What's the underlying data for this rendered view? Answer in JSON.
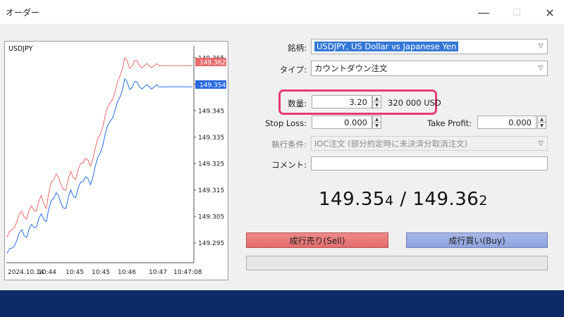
{
  "window": {
    "title": "オーダー",
    "minimize_symbol": "—",
    "maximize_symbol": "☐",
    "close_symbol": "✕"
  },
  "chart": {
    "symbol": "USDJPY",
    "ask_label": "149.362",
    "bid_label": "149.354",
    "ask_color": "#e86a6a",
    "bid_color": "#2a6ae0"
  },
  "chart_data": {
    "type": "line",
    "title": "USDJPY",
    "xlabel": "",
    "ylabel": "",
    "x_ticks": [
      "2024.10.14",
      "10:44",
      "10:45",
      "10:45",
      "10:46",
      "10:47",
      "10:47:08"
    ],
    "y_ticks": [
      "149.365",
      "149.355",
      "149.345",
      "149.335",
      "149.325",
      "149.315",
      "149.305",
      "149.295"
    ],
    "ylim": [
      149.288,
      149.369
    ],
    "grid": false,
    "series": [
      {
        "color": "#e86a6a",
        "values": [
          149.297,
          149.3,
          149.303,
          149.307,
          149.304,
          149.309,
          149.307,
          149.313,
          149.308,
          149.318,
          149.321,
          149.317,
          149.315,
          149.322,
          149.319,
          149.325,
          149.327,
          149.324,
          149.331,
          149.336,
          149.343,
          149.348,
          149.352,
          149.358,
          149.365,
          149.361,
          149.364,
          149.362,
          149.362,
          149.362,
          149.362,
          149.362
        ]
      },
      {
        "color": "#2a6ae0",
        "values": [
          149.291,
          149.293,
          149.296,
          149.3,
          149.297,
          149.302,
          149.301,
          149.306,
          149.303,
          149.311,
          149.314,
          149.31,
          149.308,
          149.315,
          149.312,
          149.318,
          149.32,
          149.317,
          149.324,
          149.329,
          149.336,
          149.341,
          149.345,
          149.35,
          149.357,
          149.353,
          149.356,
          149.354,
          149.354,
          149.354,
          149.354,
          149.354
        ]
      }
    ]
  },
  "form": {
    "symbol_label": "銘柄:",
    "symbol_value": "USDJPY, US Dollar vs Japanese Yen",
    "type_label": "タイプ:",
    "type_value": "カウントダウン注文",
    "volume_label": "数量:",
    "volume_value": "3.20",
    "volume_usd": "320 000 USD",
    "sl_label": "Stop Loss:",
    "sl_value": "0.000",
    "tp_label": "Take Profit:",
    "tp_value": "0.000",
    "fill_label": "執行条件:",
    "fill_value": "IOC注文 (部分約定時に未決済分取消注文)",
    "comment_label": "コメント:",
    "comment_value": ""
  },
  "quote": {
    "bid_main": "149.35",
    "bid_pip": "4",
    "separator": " / ",
    "ask_main": "149.36",
    "ask_pip": "2"
  },
  "buttons": {
    "sell": "成行売り(Sell)",
    "buy": "成行買い(Buy)"
  },
  "colors": {
    "highlight": "#e83a7a",
    "selection": "#3478d6",
    "footer": "#0d2a66"
  }
}
